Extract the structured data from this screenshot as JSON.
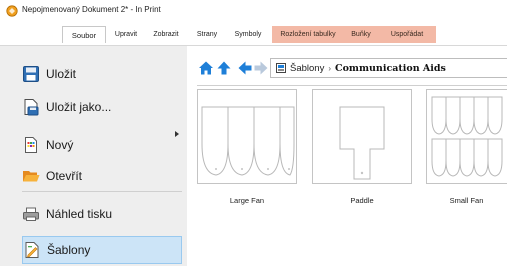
{
  "window": {
    "title": "Nepojmenovaný Dokument 2* - In Print"
  },
  "ribbon": {
    "tabs": [
      {
        "label": "Soubor"
      },
      {
        "label": "Upravit"
      },
      {
        "label": "Zobrazit"
      },
      {
        "label": "Strany"
      },
      {
        "label": "Symboly"
      },
      {
        "label": "Rozložení tabulky"
      },
      {
        "label": "Buňky"
      },
      {
        "label": "Uspořádat"
      }
    ],
    "active_tab": "Soubor",
    "context_tab_color": "#f3b9a6"
  },
  "file_menu": {
    "items": [
      {
        "label": "Uložit",
        "icon": "save-icon"
      },
      {
        "label": "Uložit jako...",
        "icon": "save-as-icon",
        "has_submenu": true
      },
      {
        "label": "Nový",
        "icon": "new-document-icon"
      },
      {
        "label": "Otevřít",
        "icon": "open-folder-icon"
      },
      {
        "label": "Náhled tisku",
        "icon": "print-preview-icon"
      },
      {
        "label": "Šablony",
        "icon": "templates-icon",
        "selected": true
      }
    ],
    "selected_color": "#cce4f7"
  },
  "navigation": {
    "path_root": "Šablony",
    "path_current": "Communication Aids"
  },
  "templates": [
    {
      "label": "Large Fan"
    },
    {
      "label": "Paddle"
    },
    {
      "label": "Small Fan"
    }
  ],
  "colors": {
    "accent": "#1e88e5",
    "nav_blue": "#1e7fd8"
  }
}
